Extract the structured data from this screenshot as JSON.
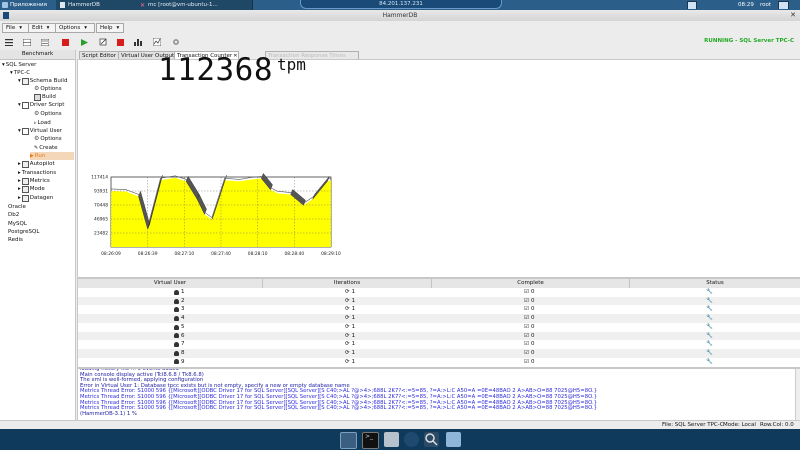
{
  "desktop": {
    "apps_label": "Приложения",
    "tasks": [
      {
        "label": "HammerDB"
      },
      {
        "label": "mc [root@vm-ubuntu-1..."
      }
    ],
    "ip": "84.201.137.231",
    "clock": "08:29",
    "user": "root"
  },
  "window": {
    "title": "HammerDB"
  },
  "menubar": {
    "items": [
      {
        "label": "File"
      },
      {
        "label": "Edit"
      },
      {
        "label": "Options"
      },
      {
        "label": "Help"
      }
    ]
  },
  "status": {
    "running": "RUNNING - SQL Server TPC-C"
  },
  "tree": {
    "header": "Benchmark",
    "nodes": [
      {
        "label": "SQL Server"
      },
      {
        "label": "TPC-C"
      },
      {
        "label": "Schema Build"
      },
      {
        "label": "Options"
      },
      {
        "label": "Build"
      },
      {
        "label": "Driver Script"
      },
      {
        "label": "Options"
      },
      {
        "label": "Load"
      },
      {
        "label": "Virtual User"
      },
      {
        "label": "Options"
      },
      {
        "label": "Create"
      },
      {
        "label": "Run"
      },
      {
        "label": "Autopilot"
      },
      {
        "label": "Transactions"
      },
      {
        "label": "Metrics"
      },
      {
        "label": "Mode"
      },
      {
        "label": "Datagen"
      },
      {
        "label": "Oracle"
      },
      {
        "label": "Db2"
      },
      {
        "label": "MySQL"
      },
      {
        "label": "PostgreSQL"
      },
      {
        "label": "Redis"
      }
    ]
  },
  "tabs": [
    {
      "label": "Script Editor"
    },
    {
      "label": "Virtual User Output"
    },
    {
      "label": "Transaction Counter"
    },
    {
      "label": "Transaction Response Times"
    }
  ],
  "counter": {
    "value": "112368",
    "unit": "tpm"
  },
  "chart_data": {
    "type": "area",
    "x": [
      "08:26:09",
      "08:26:39",
      "08:27:10",
      "08:27:40",
      "08:28:10",
      "08:28:40",
      "08:29:10"
    ],
    "yticks": [
      23482,
      46965,
      70448,
      93931,
      117414
    ],
    "ylim": [
      0,
      117414
    ],
    "points": [
      [
        0,
        94000
      ],
      [
        0.4,
        93000
      ],
      [
        0.75,
        85000
      ],
      [
        1.0,
        30000
      ],
      [
        1.35,
        112000
      ],
      [
        1.75,
        116000
      ],
      [
        2.05,
        110000
      ],
      [
        2.35,
        80000
      ],
      [
        2.55,
        55000
      ],
      [
        2.75,
        46000
      ],
      [
        3.1,
        112000
      ],
      [
        3.5,
        110000
      ],
      [
        3.8,
        113000
      ],
      [
        4.1,
        115000
      ],
      [
        4.35,
        96000
      ],
      [
        4.55,
        90000
      ],
      [
        4.9,
        88000
      ],
      [
        5.25,
        70000
      ],
      [
        5.5,
        80000
      ],
      [
        5.9,
        110000
      ],
      [
        6.0,
        112000
      ]
    ],
    "grid": true,
    "fill_color": "#ffff00",
    "edge_color": "#555555"
  },
  "grid": {
    "headers": [
      "Virtual User",
      "Iterations",
      "Complete",
      "Status"
    ],
    "rows": [
      {
        "user": "1",
        "iterations": "1",
        "complete": "0"
      },
      {
        "user": "2",
        "iterations": "1",
        "complete": "0"
      },
      {
        "user": "3",
        "iterations": "1",
        "complete": "0"
      },
      {
        "user": "4",
        "iterations": "1",
        "complete": "0"
      },
      {
        "user": "5",
        "iterations": "1",
        "complete": "0"
      },
      {
        "user": "6",
        "iterations": "1",
        "complete": "0"
      },
      {
        "user": "7",
        "iterations": "1",
        "complete": "0"
      },
      {
        "user": "8",
        "iterations": "1",
        "complete": "0"
      },
      {
        "user": "9",
        "iterations": "1",
        "complete": "0"
      }
    ]
  },
  "console": {
    "lines": [
      {
        "text": "loading history file ... 5 events added",
        "color": "#1a1aa0"
      },
      {
        "text": "Main console display active (Tcl8.6.8 / Tk8.6.8)",
        "color": "#1a1aa0"
      },
      {
        "text": "The xml is well-formed, applying configuration",
        "color": "#1a1aa0"
      },
      {
        "text": "Error in Virtual User 1: Database tpcc exists but is not empty, specify a new or empty database name",
        "color": "#1a1aa0"
      },
      {
        "text": "Metrics Thread Error: S1000 596 {[Microsoft][ODBC Driver 17 for SQL Server][SQL Server][S C40;>AL ?@>4>;688L 2K7?<:=5=85, ?=A:>L:C A50=A =0E=48BAO 2 A>AB>O=88 7025@H5=8O.}",
        "color": "#2b2bdb"
      },
      {
        "text": "Metrics Thread Error: S1000 596 {[Microsoft][ODBC Driver 17 for SQL Server][SQL Server][S C40;>AL ?@>4>;688L 2K7?<:=5=85, ?=A:>L:C A50=A =0E=48BAO 2 A>AB>O=88 7025@H5=8O.}",
        "color": "#2b2bdb"
      },
      {
        "text": "Metrics Thread Error: S1000 596 {[Microsoft][ODBC Driver 17 for SQL Server][SQL Server][S C40;>AL ?@>4>;688L 2K7?<:=5=85, ?=A:>L:C A50=A =0E=48BAO 2 A>AB>O=88 7025@H5=8O.}",
        "color": "#2b2bdb"
      },
      {
        "text": "Metrics Thread Error: S1000 596 {[Microsoft][ODBC Driver 17 for SQL Server][SQL Server][S C40;>AL ?@>4>;688L 2K7?<:=5=85, ?=A:>L:C A50=A =0E=48BAO 2 A>AB>O=88 7025@H5=8O.}",
        "color": "#2b2bdb"
      },
      {
        "text": "(HammerDB-3.1) 1 %",
        "color": "#1a1aa0"
      }
    ]
  },
  "statusbar": {
    "file": "File: SQL Server TPC-C",
    "mode": "Mode: Local",
    "rowcol": "Row.Col:  0.0"
  }
}
